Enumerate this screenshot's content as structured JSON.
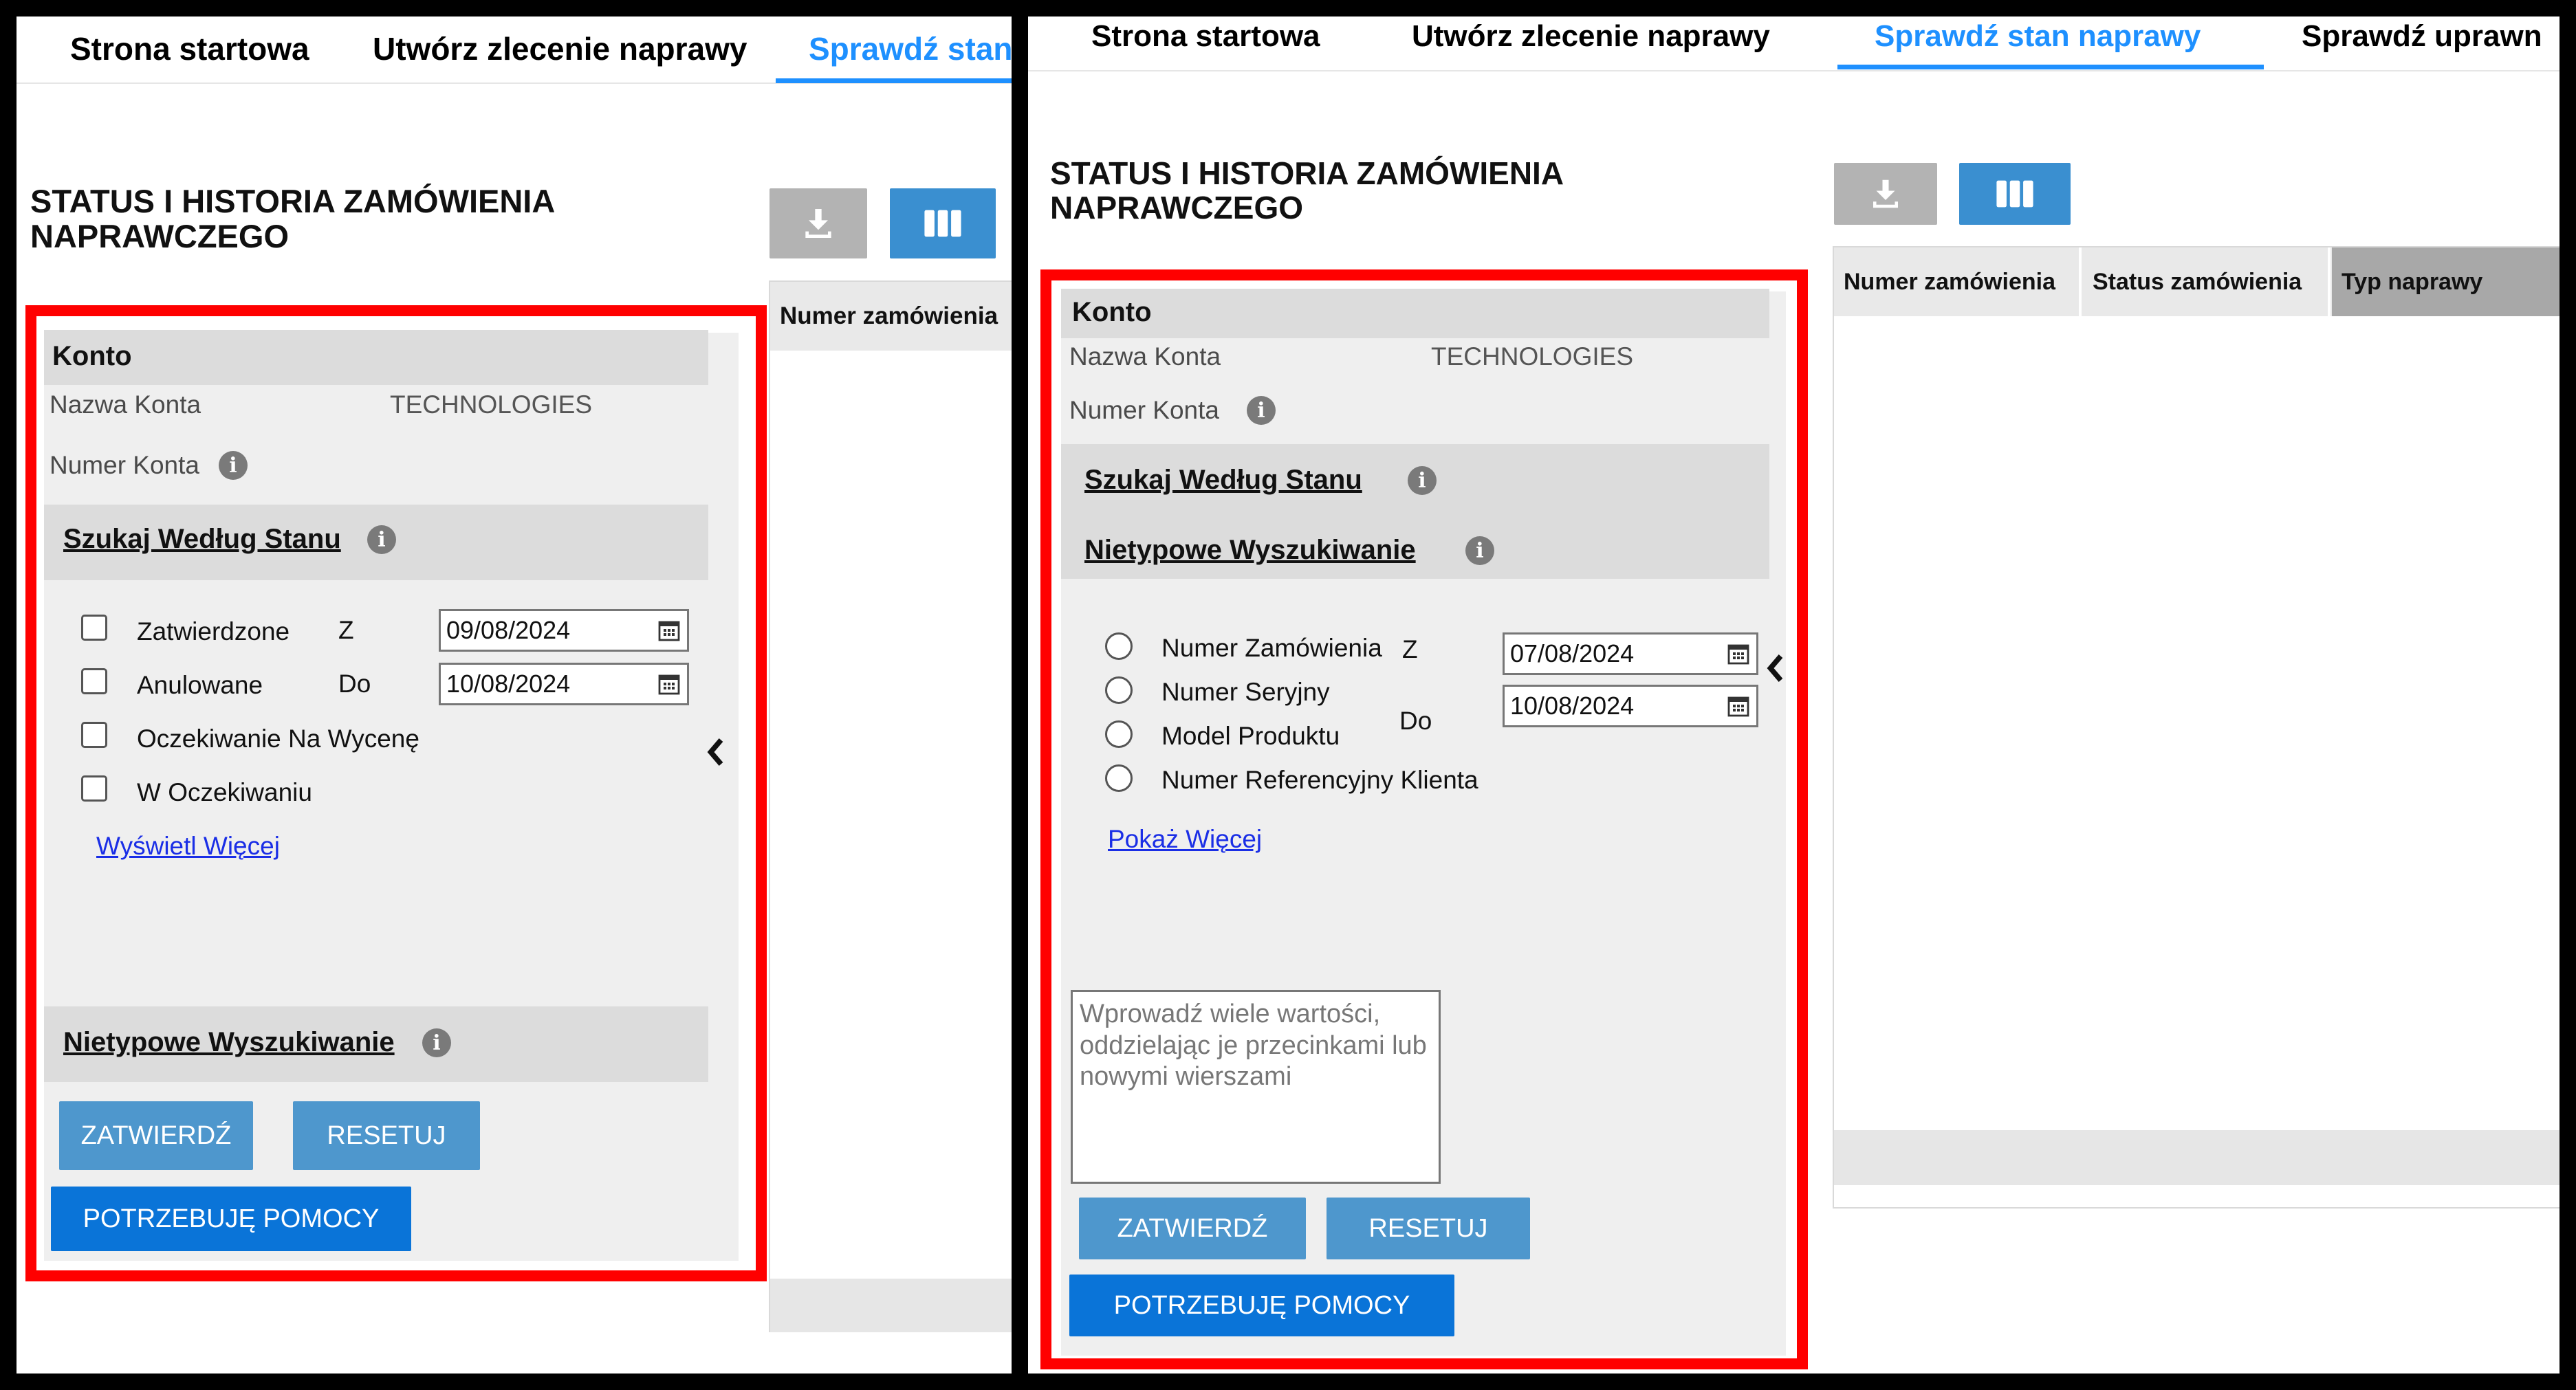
{
  "left": {
    "tabs": [
      "Strona startowa",
      "Utwórz zlecenie naprawy",
      "Sprawdź stan"
    ],
    "title_line1": "STATUS I HISTORIA ZAMÓWIENIA",
    "title_line2": "NAPRAWCZEGO",
    "account": {
      "heading": "Konto",
      "name_label": "Nazwa Konta",
      "name_value": "TECHNOLOGIES",
      "number_label": "Numer Konta"
    },
    "search_by_status": "Szukaj Według Stanu",
    "statuses": [
      "Zatwierdzone",
      "Anulowane",
      "Oczekiwanie Na Wycenę",
      "W Oczekiwaniu"
    ],
    "from_label": "Z",
    "to_label": "Do",
    "from_date": "09/08/2024",
    "to_date": "10/08/2024",
    "show_more": "Wyświetl Więcej",
    "custom_search": "Nietypowe Wyszukiwanie",
    "approve": "ZATWIERDŹ",
    "reset": "RESETUJ",
    "help": "POTRZEBUJĘ POMOCY",
    "grid_columns": [
      "Numer zamówienia"
    ]
  },
  "right": {
    "tabs": [
      "Strona startowa",
      "Utwórz zlecenie naprawy",
      "Sprawdź stan naprawy",
      "Sprawdź uprawn"
    ],
    "title_line1": "STATUS I HISTORIA ZAMÓWIENIA",
    "title_line2": "NAPRAWCZEGO",
    "account": {
      "heading": "Konto",
      "name_label": "Nazwa Konta",
      "name_value": "TECHNOLOGIES",
      "number_label": "Numer Konta"
    },
    "search_by_status": "Szukaj Według Stanu",
    "custom_search": "Nietypowe Wyszukiwanie",
    "search_types": [
      "Numer Zamówienia",
      "Numer Seryjny",
      "Model Produktu",
      "Numer Referencyjny Klienta"
    ],
    "from_label": "Z",
    "to_label": "Do",
    "from_date": "07/08/2024",
    "to_date": "10/08/2024",
    "show_more": "Pokaż Więcej",
    "textarea_placeholder": "Wprowadź wiele wartości, oddzielając je przecinkami lub nowymi wierszami",
    "approve": "ZATWIERDŹ",
    "reset": "RESETUJ",
    "help": "POTRZEBUJĘ POMOCY",
    "grid_columns": [
      "Numer zamówienia",
      "Status zamówienia",
      "Typ naprawy"
    ]
  },
  "colors": {
    "tab_active": "#1e90ff",
    "highlight_box": "#ff0000",
    "button_light": "#4e97cd",
    "button_strong": "#0a74d8",
    "link": "#1a2ee6"
  }
}
